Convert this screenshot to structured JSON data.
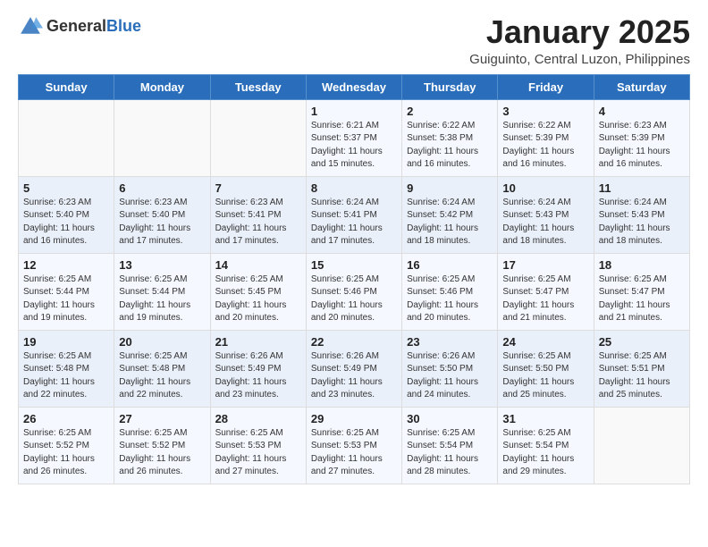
{
  "header": {
    "logo_general": "General",
    "logo_blue": "Blue",
    "month_title": "January 2025",
    "location": "Guiguinto, Central Luzon, Philippines"
  },
  "days_of_week": [
    "Sunday",
    "Monday",
    "Tuesday",
    "Wednesday",
    "Thursday",
    "Friday",
    "Saturday"
  ],
  "weeks": [
    [
      {
        "day": "",
        "info": ""
      },
      {
        "day": "",
        "info": ""
      },
      {
        "day": "",
        "info": ""
      },
      {
        "day": "1",
        "info": "Sunrise: 6:21 AM\nSunset: 5:37 PM\nDaylight: 11 hours and 15 minutes."
      },
      {
        "day": "2",
        "info": "Sunrise: 6:22 AM\nSunset: 5:38 PM\nDaylight: 11 hours and 16 minutes."
      },
      {
        "day": "3",
        "info": "Sunrise: 6:22 AM\nSunset: 5:39 PM\nDaylight: 11 hours and 16 minutes."
      },
      {
        "day": "4",
        "info": "Sunrise: 6:23 AM\nSunset: 5:39 PM\nDaylight: 11 hours and 16 minutes."
      }
    ],
    [
      {
        "day": "5",
        "info": "Sunrise: 6:23 AM\nSunset: 5:40 PM\nDaylight: 11 hours and 16 minutes."
      },
      {
        "day": "6",
        "info": "Sunrise: 6:23 AM\nSunset: 5:40 PM\nDaylight: 11 hours and 17 minutes."
      },
      {
        "day": "7",
        "info": "Sunrise: 6:23 AM\nSunset: 5:41 PM\nDaylight: 11 hours and 17 minutes."
      },
      {
        "day": "8",
        "info": "Sunrise: 6:24 AM\nSunset: 5:41 PM\nDaylight: 11 hours and 17 minutes."
      },
      {
        "day": "9",
        "info": "Sunrise: 6:24 AM\nSunset: 5:42 PM\nDaylight: 11 hours and 18 minutes."
      },
      {
        "day": "10",
        "info": "Sunrise: 6:24 AM\nSunset: 5:43 PM\nDaylight: 11 hours and 18 minutes."
      },
      {
        "day": "11",
        "info": "Sunrise: 6:24 AM\nSunset: 5:43 PM\nDaylight: 11 hours and 18 minutes."
      }
    ],
    [
      {
        "day": "12",
        "info": "Sunrise: 6:25 AM\nSunset: 5:44 PM\nDaylight: 11 hours and 19 minutes."
      },
      {
        "day": "13",
        "info": "Sunrise: 6:25 AM\nSunset: 5:44 PM\nDaylight: 11 hours and 19 minutes."
      },
      {
        "day": "14",
        "info": "Sunrise: 6:25 AM\nSunset: 5:45 PM\nDaylight: 11 hours and 20 minutes."
      },
      {
        "day": "15",
        "info": "Sunrise: 6:25 AM\nSunset: 5:46 PM\nDaylight: 11 hours and 20 minutes."
      },
      {
        "day": "16",
        "info": "Sunrise: 6:25 AM\nSunset: 5:46 PM\nDaylight: 11 hours and 20 minutes."
      },
      {
        "day": "17",
        "info": "Sunrise: 6:25 AM\nSunset: 5:47 PM\nDaylight: 11 hours and 21 minutes."
      },
      {
        "day": "18",
        "info": "Sunrise: 6:25 AM\nSunset: 5:47 PM\nDaylight: 11 hours and 21 minutes."
      }
    ],
    [
      {
        "day": "19",
        "info": "Sunrise: 6:25 AM\nSunset: 5:48 PM\nDaylight: 11 hours and 22 minutes."
      },
      {
        "day": "20",
        "info": "Sunrise: 6:25 AM\nSunset: 5:48 PM\nDaylight: 11 hours and 22 minutes."
      },
      {
        "day": "21",
        "info": "Sunrise: 6:26 AM\nSunset: 5:49 PM\nDaylight: 11 hours and 23 minutes."
      },
      {
        "day": "22",
        "info": "Sunrise: 6:26 AM\nSunset: 5:49 PM\nDaylight: 11 hours and 23 minutes."
      },
      {
        "day": "23",
        "info": "Sunrise: 6:26 AM\nSunset: 5:50 PM\nDaylight: 11 hours and 24 minutes."
      },
      {
        "day": "24",
        "info": "Sunrise: 6:25 AM\nSunset: 5:50 PM\nDaylight: 11 hours and 25 minutes."
      },
      {
        "day": "25",
        "info": "Sunrise: 6:25 AM\nSunset: 5:51 PM\nDaylight: 11 hours and 25 minutes."
      }
    ],
    [
      {
        "day": "26",
        "info": "Sunrise: 6:25 AM\nSunset: 5:52 PM\nDaylight: 11 hours and 26 minutes."
      },
      {
        "day": "27",
        "info": "Sunrise: 6:25 AM\nSunset: 5:52 PM\nDaylight: 11 hours and 26 minutes."
      },
      {
        "day": "28",
        "info": "Sunrise: 6:25 AM\nSunset: 5:53 PM\nDaylight: 11 hours and 27 minutes."
      },
      {
        "day": "29",
        "info": "Sunrise: 6:25 AM\nSunset: 5:53 PM\nDaylight: 11 hours and 27 minutes."
      },
      {
        "day": "30",
        "info": "Sunrise: 6:25 AM\nSunset: 5:54 PM\nDaylight: 11 hours and 28 minutes."
      },
      {
        "day": "31",
        "info": "Sunrise: 6:25 AM\nSunset: 5:54 PM\nDaylight: 11 hours and 29 minutes."
      },
      {
        "day": "",
        "info": ""
      }
    ]
  ]
}
